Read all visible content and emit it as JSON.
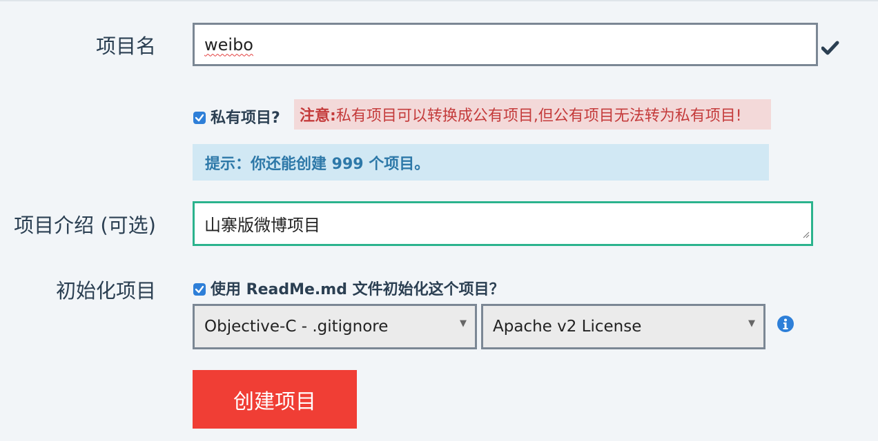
{
  "form": {
    "project_name": {
      "label": "项目名",
      "value": "weibo"
    },
    "private": {
      "label": "私有项目?",
      "checked": true,
      "warning_prefix": "注意:",
      "warning_text": " 私有项目可以转换成公有项目,但公有项目无法转为私有项目!"
    },
    "tip": {
      "text": "提示：你还能创建 999 个项目。"
    },
    "description": {
      "label": "项目介绍 (可选)",
      "value": "山寨版微博项目"
    },
    "init": {
      "label": "初始化项目",
      "checkbox_label": "使用 ReadMe.md 文件初始化这个项目？",
      "checked": true,
      "gitignore_selected": "Objective-C - .gitignore",
      "license_selected": "Apache v2 License"
    },
    "submit_label": "创建项目"
  },
  "colors": {
    "accent_blue": "#2e7fd8",
    "danger_red": "#f03e35",
    "valid_green": "#2bb38d"
  },
  "icons": [
    "checkmark-icon",
    "checkbox-icon",
    "dropdown-caret-icon",
    "info-icon"
  ]
}
